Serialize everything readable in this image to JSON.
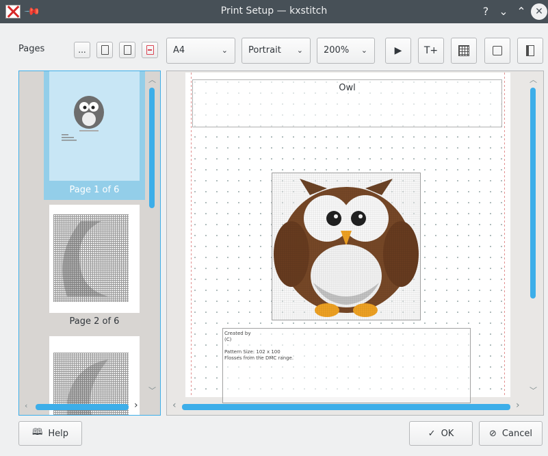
{
  "window": {
    "title": "Print Setup — kxstitch",
    "help_glyph": "?",
    "minimize_glyph": "⌄",
    "maximize_glyph": "⌃",
    "close_glyph": "✕"
  },
  "toolbar": {
    "pages_label": "Pages",
    "more_label": "...",
    "paper_size": "A4",
    "orientation": "Portrait",
    "zoom": "200%",
    "text_tool_glyph": "T+"
  },
  "thumbnails": [
    {
      "caption": "Page 1 of 6",
      "selected": true
    },
    {
      "caption": "Page 2 of 6",
      "selected": false
    },
    {
      "caption": "",
      "selected": false
    }
  ],
  "preview": {
    "title": "Owl",
    "info_lines": [
      "Created by",
      "(C)",
      "",
      "Pattern Size: 102 x 100",
      "Flosses from the DMC range."
    ]
  },
  "buttons": {
    "help": "Help",
    "ok": "OK",
    "cancel": "Cancel"
  },
  "colors": {
    "accent": "#3daee9",
    "titlebar": "#475057",
    "owl_brown": "#7a4a28",
    "owl_beak": "#f5a623"
  }
}
